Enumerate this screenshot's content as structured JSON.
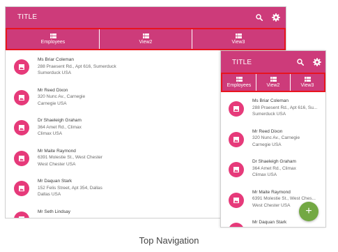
{
  "app": {
    "title": "TITLE"
  },
  "tabs": [
    {
      "label": "Employees",
      "icon": "grid-icon"
    },
    {
      "label": "View2",
      "icon": "grid-icon"
    },
    {
      "label": "View3",
      "icon": "grid-icon"
    }
  ],
  "contacts_large": [
    {
      "name": "Ms Briar Coleman",
      "address": "288 Praesent Rd., Apt 616, Sumerduck",
      "city": "Sumerduck USA"
    },
    {
      "name": "Mr Reed Dixon",
      "address": "320 Nunc Av., Carnegie",
      "city": "Carnegie USA"
    },
    {
      "name": "Dr Shaeleigh Graham",
      "address": "364 Amet Rd., Climax",
      "city": "Climax USA"
    },
    {
      "name": "Mr Maite Raymond",
      "address": "6391 Molestie St., West Chester",
      "city": "West Chester USA"
    },
    {
      "name": "Mr Daquan Stark",
      "address": "152 Felis Street, Apt 354, Dallas",
      "city": "Dallas USA"
    },
    {
      "name": "Mr Seth Lindsay",
      "address": "",
      "city": ""
    }
  ],
  "contacts_small": [
    {
      "name": "Ms Briar Coleman",
      "address": "288 Praesent Rd., Apt 616, Su...",
      "city": "Sumerduck USA"
    },
    {
      "name": "Mr Reed Dixon",
      "address": "320 Nunc Av., Carnegie",
      "city": "Carnegie USA"
    },
    {
      "name": "Dr Shaeleigh Graham",
      "address": "364 Amet Rd., Climax",
      "city": "Climax USA"
    },
    {
      "name": "Mr Maite Raymond",
      "address": "6391 Molestie St., West Ches...",
      "city": "West Chester USA"
    },
    {
      "name": "Mr Daquan Stark",
      "address": "",
      "city": ""
    }
  ],
  "fab": {
    "label": "+"
  },
  "caption": "Top Navigation",
  "colors": {
    "primary": "#cd3b7a",
    "avatar": "#e63a7a",
    "highlight": "#e8141e",
    "fab": "#73a843"
  }
}
